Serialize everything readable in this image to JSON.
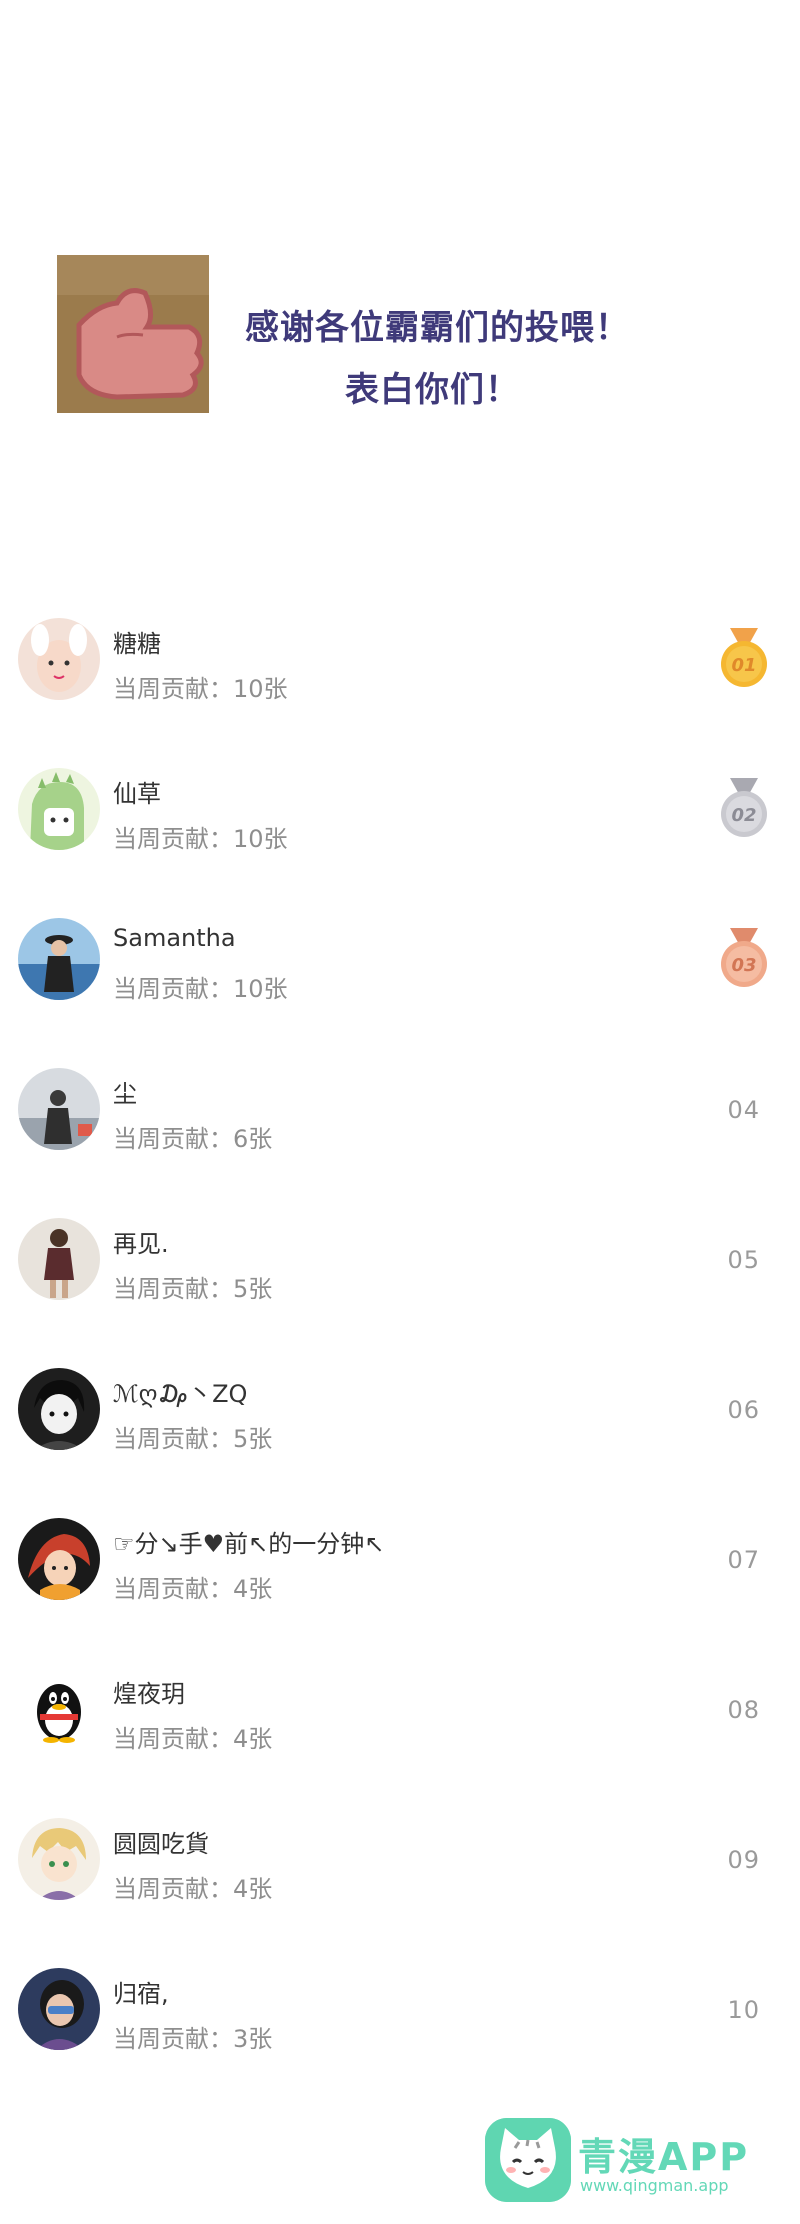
{
  "header": {
    "title_line1": "感谢各位霸霸们的投喂！",
    "title_line2": "表白你们！"
  },
  "colors": {
    "title": "#3f3a7a",
    "gold": "#f5b731",
    "silver": "#c9c9cf",
    "bronze": "#f0a98a",
    "watermark": "#63d8b7"
  },
  "rankings": [
    {
      "name": "糖糖",
      "contribution": "当周贡献：10张",
      "rank": "01",
      "medal": "gold"
    },
    {
      "name": "仙草",
      "contribution": "当周贡献：10张",
      "rank": "02",
      "medal": "silver"
    },
    {
      "name": "Samantha",
      "contribution": "当周贡献：10张",
      "rank": "03",
      "medal": "bronze"
    },
    {
      "name": "尘",
      "contribution": "当周贡献：6张",
      "rank": "04"
    },
    {
      "name": "再见.",
      "contribution": "当周贡献：5张",
      "rank": "05"
    },
    {
      "name": "ℳღ₯丶ZQ",
      "contribution": "当周贡献：5张",
      "rank": "06"
    },
    {
      "name": "☞分↘手♥前↖的一分钟↖",
      "contribution": "当周贡献：4张",
      "rank": "07"
    },
    {
      "name": "煌夜玥",
      "contribution": "当周贡献：4张",
      "rank": "08"
    },
    {
      "name": "圆圆吃貨",
      "contribution": "当周贡献：4张",
      "rank": "09"
    },
    {
      "name": "归宿,",
      "contribution": "当周贡献：3张",
      "rank": "10"
    }
  ],
  "watermark": {
    "title": "青漫APP",
    "url": "www.qingman.app"
  }
}
